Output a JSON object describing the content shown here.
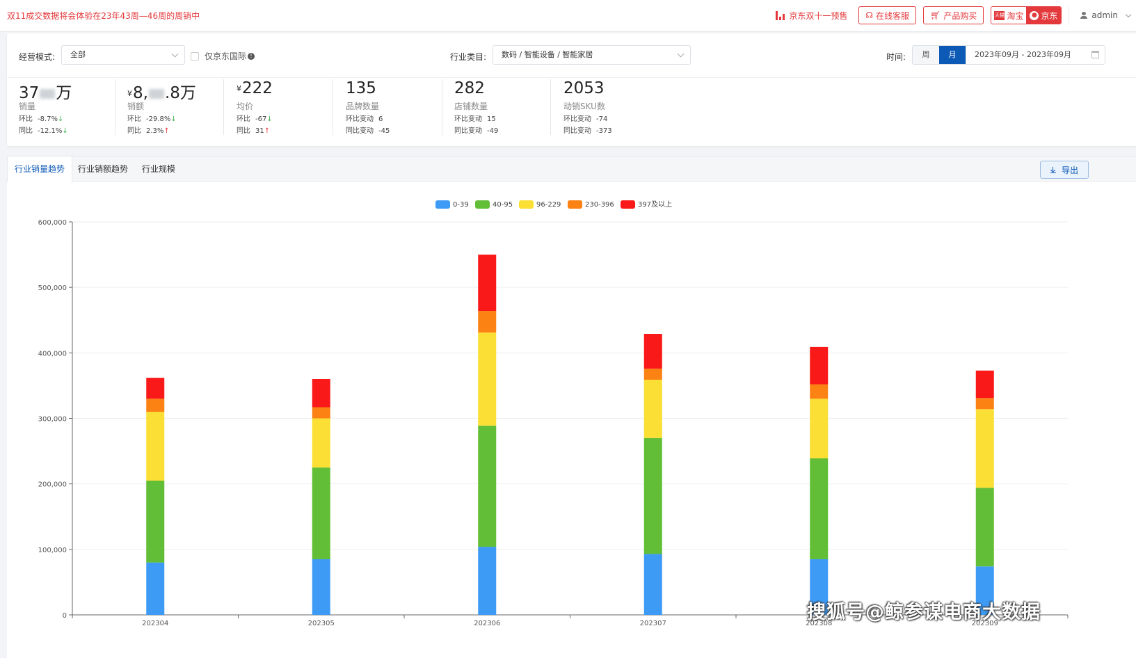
{
  "notice": "双11成交数据将会体验在23年43周—46周的周销中",
  "header": {
    "presale": "京东双十一预售",
    "online_service": "在线客服",
    "buy_product": "产品购买",
    "platform_taobao": "淘宝",
    "platform_jd": "京东",
    "user": "admin"
  },
  "filters": {
    "mode_label": "经营模式:",
    "mode_value": "全部",
    "jd_intl_label": "仅京东国际",
    "category_label": "行业类目:",
    "category_value": "数码 / 智能设备 / 智能家居",
    "time_label": "时间:",
    "time_week": "周",
    "time_month": "月",
    "time_range": "2023年09月 - 2023年09月"
  },
  "kpis": [
    {
      "value_pre": "37",
      "value_post": "万",
      "currency": "",
      "label": "销量",
      "r1_key": "环比",
      "r1_val": "-8.7%",
      "r1_dir": "down",
      "r2_key": "同比",
      "r2_val": "-12.1%",
      "r2_dir": "down"
    },
    {
      "value_pre": "8,",
      "value_post": ".8万",
      "currency": "¥",
      "label": "销额",
      "r1_key": "环比",
      "r1_val": "-29.8%",
      "r1_dir": "down",
      "r2_key": "同比",
      "r2_val": "2.3%",
      "r2_dir": "up"
    },
    {
      "value_pre": "222",
      "value_post": "",
      "currency": "¥",
      "label": "均价",
      "r1_key": "环比",
      "r1_val": "-67",
      "r1_dir": "down",
      "r2_key": "同比",
      "r2_val": "31",
      "r2_dir": "up"
    },
    {
      "value_pre": "135",
      "value_post": "",
      "currency": "",
      "label": "品牌数量",
      "r1_key": "环比变动",
      "r1_val": "6",
      "r1_dir": "",
      "r2_key": "同比变动",
      "r2_val": "-45",
      "r2_dir": ""
    },
    {
      "value_pre": "282",
      "value_post": "",
      "currency": "",
      "label": "店铺数量",
      "r1_key": "环比变动",
      "r1_val": "15",
      "r1_dir": "",
      "r2_key": "同比变动",
      "r2_val": "-49",
      "r2_dir": ""
    },
    {
      "value_pre": "2053",
      "value_post": "",
      "currency": "",
      "label": "动销SKU数",
      "r1_key": "环比变动",
      "r1_val": "-74",
      "r1_dir": "",
      "r2_key": "同比变动",
      "r2_val": "-373",
      "r2_dir": ""
    }
  ],
  "tabs": [
    "行业销量趋势",
    "行业销额趋势",
    "行业规模"
  ],
  "export_label": "导出",
  "watermark": "搜狐号@鲸参谋电商大数据",
  "chart_data": {
    "type": "bar",
    "stacked": true,
    "categories": [
      "202304",
      "202305",
      "202306",
      "202307",
      "202308",
      "202309"
    ],
    "series": [
      {
        "name": "0-39",
        "color": "#3e9bf5",
        "values": [
          80000,
          85000,
          104000,
          93000,
          85000,
          74000
        ]
      },
      {
        "name": "40-95",
        "color": "#62be37",
        "values": [
          125000,
          140000,
          185000,
          177000,
          154000,
          120000
        ]
      },
      {
        "name": "96-229",
        "color": "#fbdf34",
        "values": [
          105000,
          75000,
          142000,
          89000,
          91000,
          120000
        ]
      },
      {
        "name": "230-396",
        "color": "#fc8214",
        "values": [
          20000,
          17000,
          33000,
          17000,
          22000,
          17000
        ]
      },
      {
        "name": "397及以上",
        "color": "#fa1919",
        "values": [
          32000,
          43000,
          86000,
          53000,
          57000,
          42000
        ]
      }
    ],
    "ylim": [
      0,
      600000
    ],
    "yticks": [
      0,
      100000,
      200000,
      300000,
      400000,
      500000,
      600000
    ],
    "ytick_labels": [
      "0",
      "100,000",
      "200,000",
      "300,000",
      "400,000",
      "500,000",
      "600,000"
    ],
    "legend_position": "top-center",
    "grid": true
  }
}
